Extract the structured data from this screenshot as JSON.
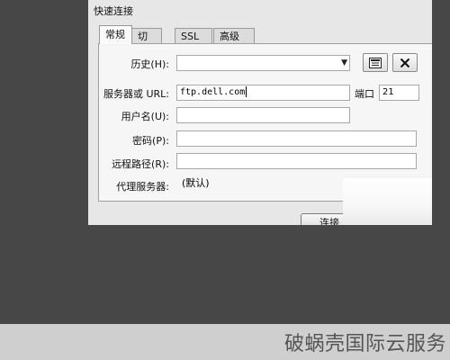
{
  "dialog": {
    "title": "快速连接",
    "tabs": [
      {
        "label": "常规",
        "active": true
      },
      {
        "label": "切换",
        "active": false
      },
      {
        "label": "SSL",
        "active": false
      },
      {
        "label": "高级",
        "active": false
      }
    ]
  },
  "form": {
    "history_label": "历史(H):",
    "history_value": "",
    "server_label": "服务器或 URL:",
    "server_value": "ftp.dell.com",
    "port_label": "端口",
    "port_value": "21",
    "username_label": "用户名(U):",
    "username_value": "",
    "password_label": "密码(P):",
    "password_value": "",
    "remote_path_label": "远程路径(R):",
    "remote_path_value": "",
    "proxy_label": "代理服务器:",
    "proxy_value": "(默认)"
  },
  "buttons": {
    "connect_label": "连接",
    "history_icon": "list-icon",
    "clear_icon": "close-icon"
  },
  "watermark": "破蜗壳国际云服务"
}
